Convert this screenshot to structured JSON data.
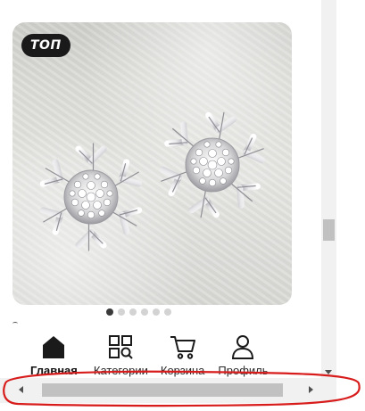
{
  "product": {
    "badge": "ТОП",
    "image_subject": "snowflake-stud-earrings"
  },
  "carousel": {
    "total": 6,
    "active_index": 0
  },
  "bottom_nav": {
    "items": [
      {
        "label": "Главная",
        "icon": "home-icon",
        "active": true
      },
      {
        "label": "Категории",
        "icon": "categories-icon",
        "active": false
      },
      {
        "label": "Корзина",
        "icon": "cart-icon",
        "active": false
      },
      {
        "label": "Профиль",
        "icon": "profile-icon",
        "active": false
      }
    ]
  },
  "colors": {
    "badge_bg": "#1a1a1a",
    "dot_active": "#3a3a3a",
    "dot_inactive": "#d3d3d3",
    "annotation": "#d81c1c"
  }
}
